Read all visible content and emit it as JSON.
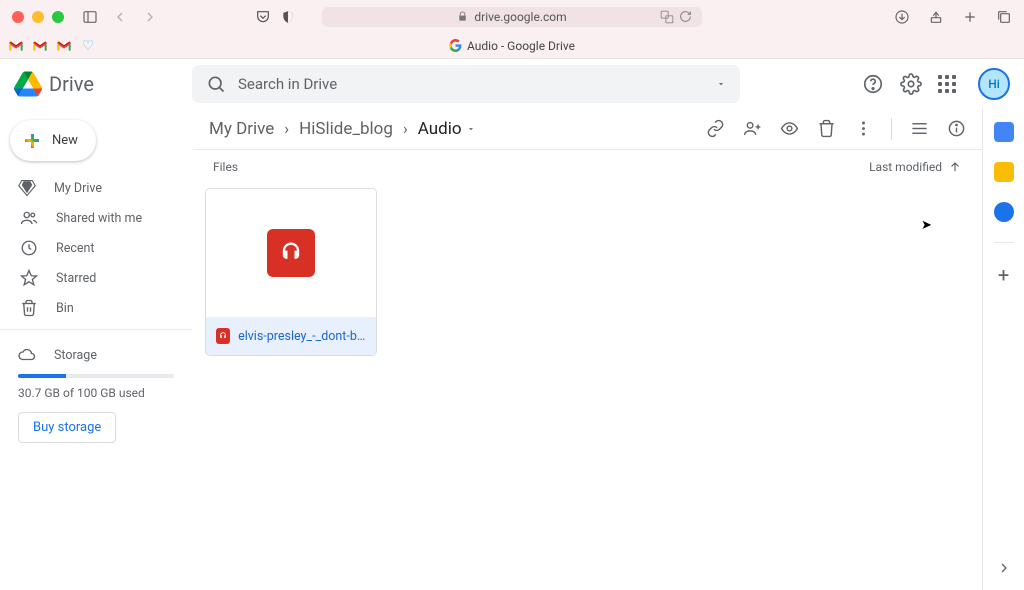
{
  "browser": {
    "url_host": "drive.google.com",
    "tab_title": "Audio - Google Drive"
  },
  "drive": {
    "product": "Drive",
    "search_placeholder": "Search in Drive"
  },
  "new_button": "New",
  "sidebar": {
    "items": [
      {
        "label": "My Drive"
      },
      {
        "label": "Shared with me"
      },
      {
        "label": "Recent"
      },
      {
        "label": "Starred"
      },
      {
        "label": "Bin"
      }
    ],
    "storage_label": "Storage",
    "storage_text": "30.7 GB of 100 GB used",
    "buy_label": "Buy storage"
  },
  "breadcrumb": {
    "items": [
      {
        "label": "My Drive"
      },
      {
        "label": "HiSlide_blog"
      },
      {
        "label": "Audio"
      }
    ]
  },
  "sort": {
    "section": "Files",
    "last_modified": "Last modified"
  },
  "file": {
    "name": "elvis-presley_-_dont-be-c..."
  }
}
